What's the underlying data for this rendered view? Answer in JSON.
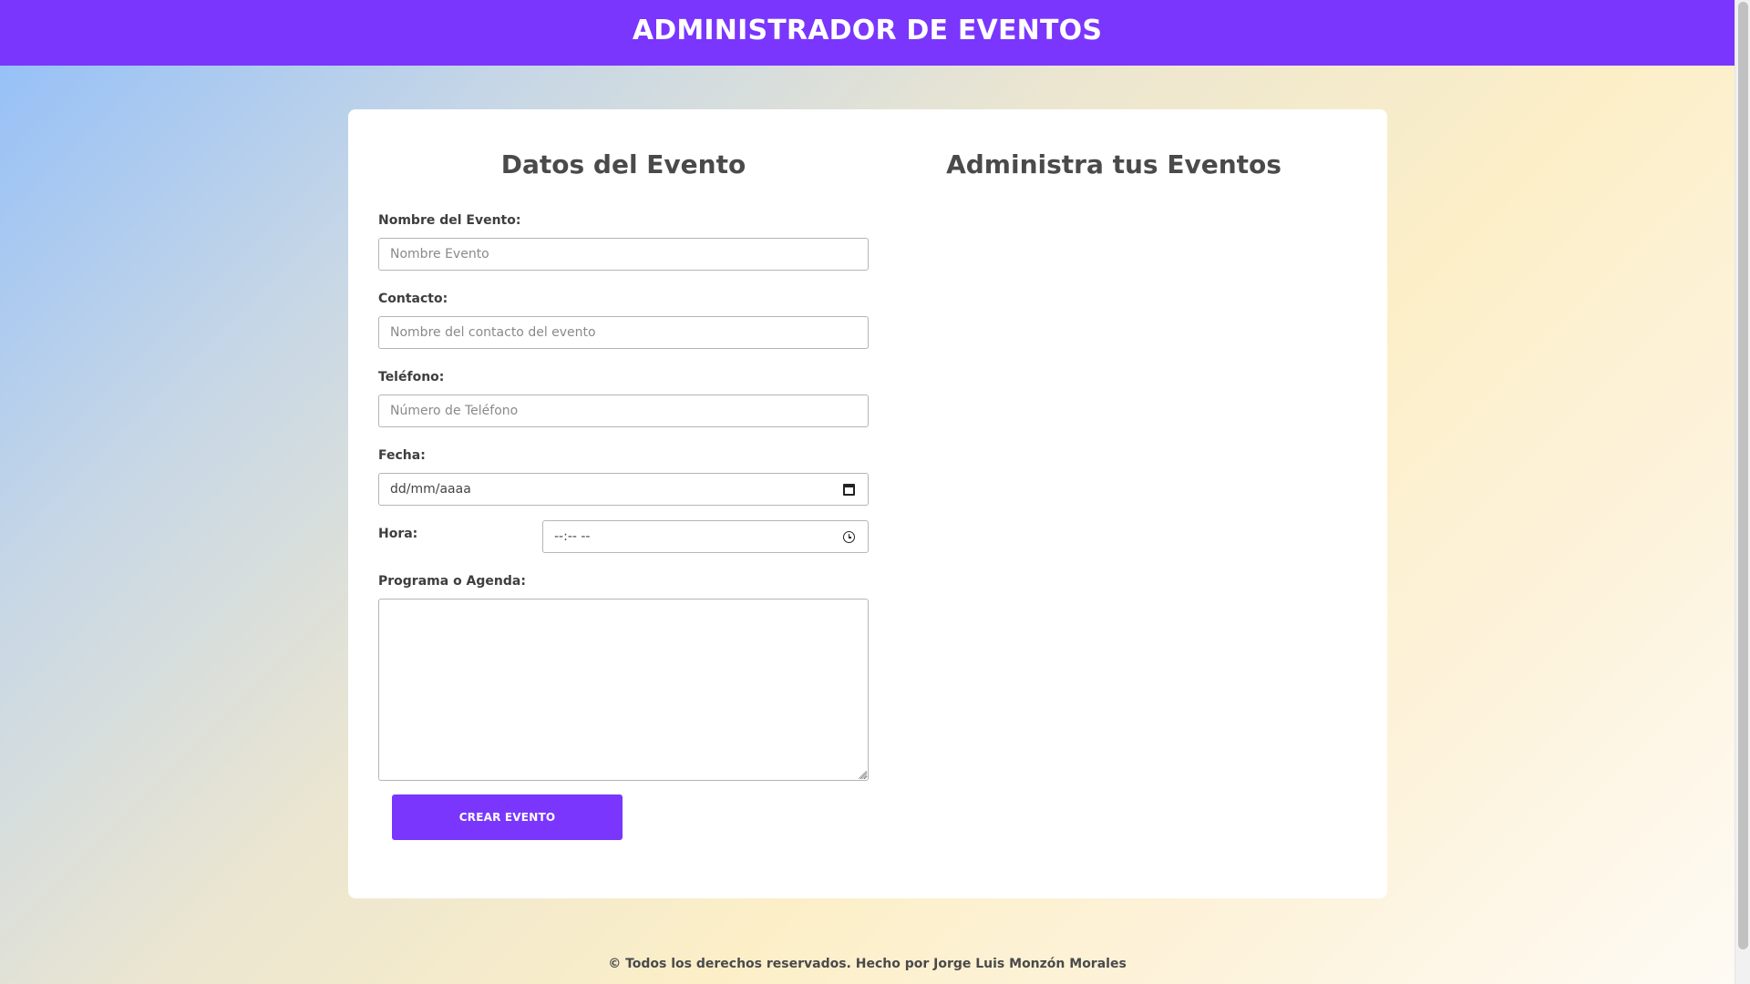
{
  "header": {
    "title": "ADMINISTRADOR DE EVENTOS"
  },
  "form": {
    "title": "Datos del Evento",
    "nombre": {
      "label": "Nombre del Evento:",
      "placeholder": "Nombre Evento",
      "value": ""
    },
    "contacto": {
      "label": "Contacto:",
      "placeholder": "Nombre del contacto del evento",
      "value": ""
    },
    "telefono": {
      "label": "Teléfono:",
      "placeholder": "Número de Teléfono",
      "value": ""
    },
    "fecha": {
      "label": "Fecha:",
      "display": "dd/mm/aaaa"
    },
    "hora": {
      "label": "Hora:",
      "display": "--:-- --"
    },
    "agenda": {
      "label": "Programa o Agenda:",
      "value": ""
    },
    "submit_label": "CREAR EVENTO"
  },
  "events": {
    "title": "Administra tus Eventos",
    "items": []
  },
  "footer": {
    "text": "© Todos los derechos reservados. Hecho por Jorge Luis Monzón Morales"
  },
  "icons": {
    "date": "calendar-icon",
    "time": "clock-icon"
  },
  "colors": {
    "accent": "#7a36fc",
    "card": "#ffffff"
  }
}
